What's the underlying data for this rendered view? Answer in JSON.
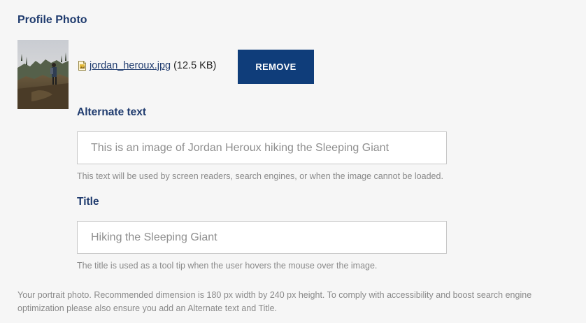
{
  "section": {
    "title": "Profile Photo"
  },
  "file": {
    "name": "jordan_heroux.jpg",
    "size": "(12.5 KB)",
    "icon": "image-file-icon"
  },
  "remove_button": {
    "label": "REMOVE"
  },
  "alt_text": {
    "label": "Alternate text",
    "placeholder": "This is an image of Jordan Heroux hiking the Sleeping Giant",
    "value": "",
    "help": "This text will be used by screen readers, search engines, or when the image cannot be loaded."
  },
  "title_field": {
    "label": "Title",
    "placeholder": "Hiking the Sleeping Giant",
    "value": "",
    "help": "The title is used as a tool tip when the user hovers the mouse over the image."
  },
  "footer": {
    "note": "Your portrait photo. Recommended dimension is 180 px width by 240 px height. To comply with accessibility and boost search engine optimization please also ensure you add an Alternate text and Title."
  },
  "colors": {
    "heading": "#1f3b6e",
    "button_bg": "#0f3d7a",
    "help_text": "#8a8a8a",
    "background": "#f6f6f6"
  }
}
